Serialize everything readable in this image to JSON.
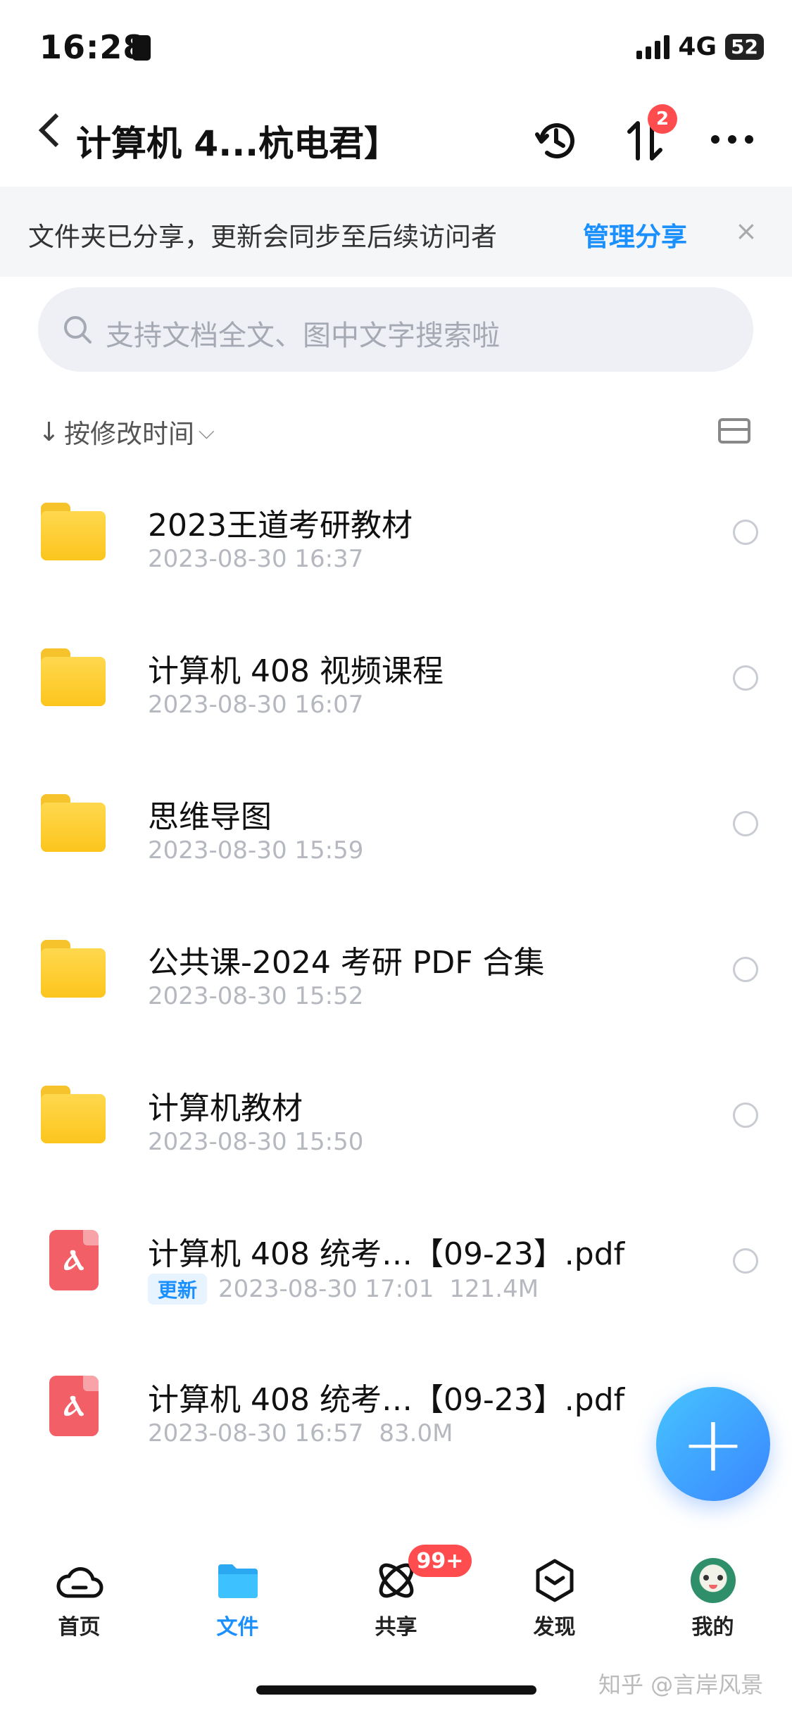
{
  "status_bar": {
    "time": "16:28",
    "network": "4G",
    "battery": "52"
  },
  "header": {
    "title": "计算机 4...杭电君】",
    "transfer_badge": "2"
  },
  "share_banner": {
    "text": "文件夹已分享，更新会同步至后续访问者",
    "link": "管理分享",
    "close": "×"
  },
  "search": {
    "placeholder": "支持文档全文、图中文字搜索啦"
  },
  "sort": {
    "arrow": "↓",
    "label": "按修改时间",
    "chevron": "⌵"
  },
  "files": [
    {
      "name": "2023王道考研教材",
      "date": "2023-08-30 16:37",
      "type": "folder"
    },
    {
      "name": "计算机 408 视频课程",
      "date": "2023-08-30 16:07",
      "type": "folder"
    },
    {
      "name": "思维导图",
      "date": "2023-08-30 15:59",
      "type": "folder"
    },
    {
      "name": "公共课-2024 考研 PDF 合集",
      "date": "2023-08-30 15:52",
      "type": "folder"
    },
    {
      "name": "计算机教材",
      "date": "2023-08-30 15:50",
      "type": "folder"
    },
    {
      "name": "计算机 408 统考…【09-23】.pdf",
      "tag": "更新",
      "date": "2023-08-30 17:01",
      "size": "121.4M",
      "type": "pdf"
    },
    {
      "name": "计算机 408 统考…【09-23】.pdf",
      "date": "2023-08-30 16:57",
      "size": "83.0M",
      "type": "pdf"
    }
  ],
  "fab": {
    "label": "+"
  },
  "tabbar": [
    {
      "label": "首页",
      "icon": "cloud-icon"
    },
    {
      "label": "文件",
      "icon": "folder-icon",
      "active": true
    },
    {
      "label": "共享",
      "icon": "orbit-icon",
      "badge": "99+"
    },
    {
      "label": "发现",
      "icon": "cube-icon"
    },
    {
      "label": "我的",
      "icon": "avatar-icon"
    }
  ],
  "watermark": "知乎 @言岸风景",
  "colors": {
    "accent": "#1a90ff",
    "badge": "#ff4d4f",
    "folder": "#fcc51d",
    "pdf": "#f25f66"
  }
}
